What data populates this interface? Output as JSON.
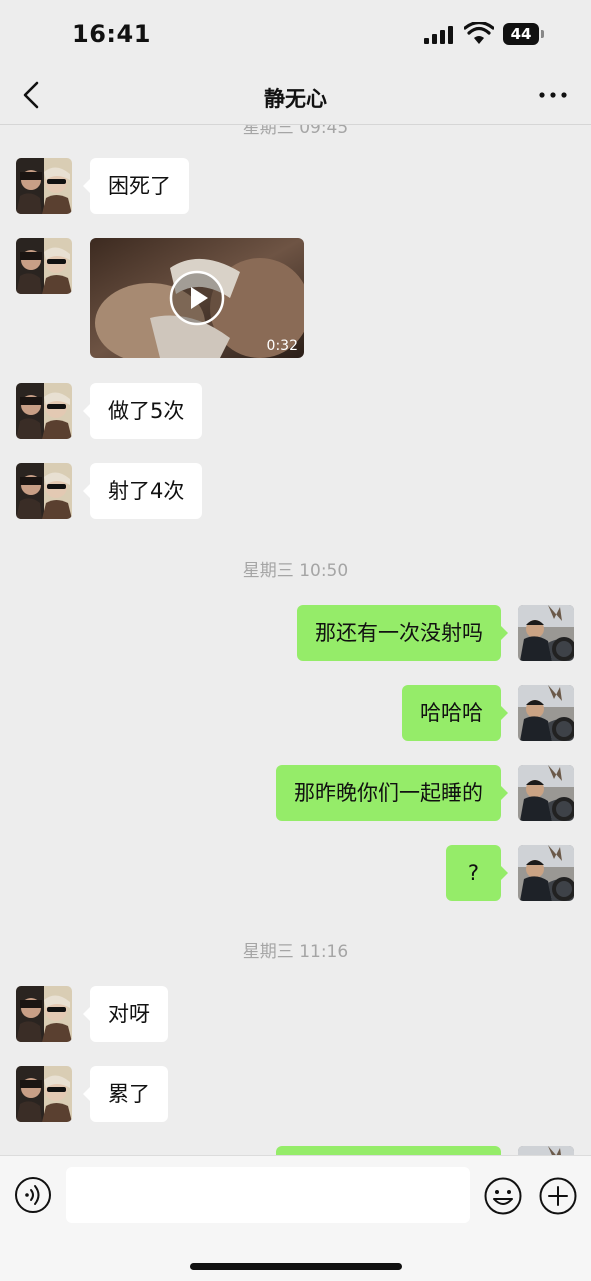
{
  "status_bar": {
    "time": "16:41",
    "battery": "44"
  },
  "nav": {
    "title": "静无心"
  },
  "chat": {
    "partial_timestamp": "星期三 09:45",
    "timestamps": [
      "星期三 10:50",
      "星期三 11:16"
    ],
    "video": {
      "duration": "0:32"
    },
    "messages_in": [
      "困死了",
      "做了5次",
      "射了4次",
      "对呀",
      "累了"
    ],
    "messages_out": [
      "那还有一次没射吗",
      "哈哈哈",
      "那昨晚你们一起睡的",
      "?"
    ]
  },
  "input": {
    "value": "",
    "placeholder": ""
  },
  "icons": {
    "back": "chevron-left-icon",
    "more": "more-icon",
    "voice": "voice-icon",
    "emoji": "emoji-icon",
    "plus": "plus-icon",
    "play": "play-icon"
  },
  "colors": {
    "outgoing_bubble": "#95ec69",
    "incoming_bubble": "#ffffff",
    "background": "#ededed"
  }
}
